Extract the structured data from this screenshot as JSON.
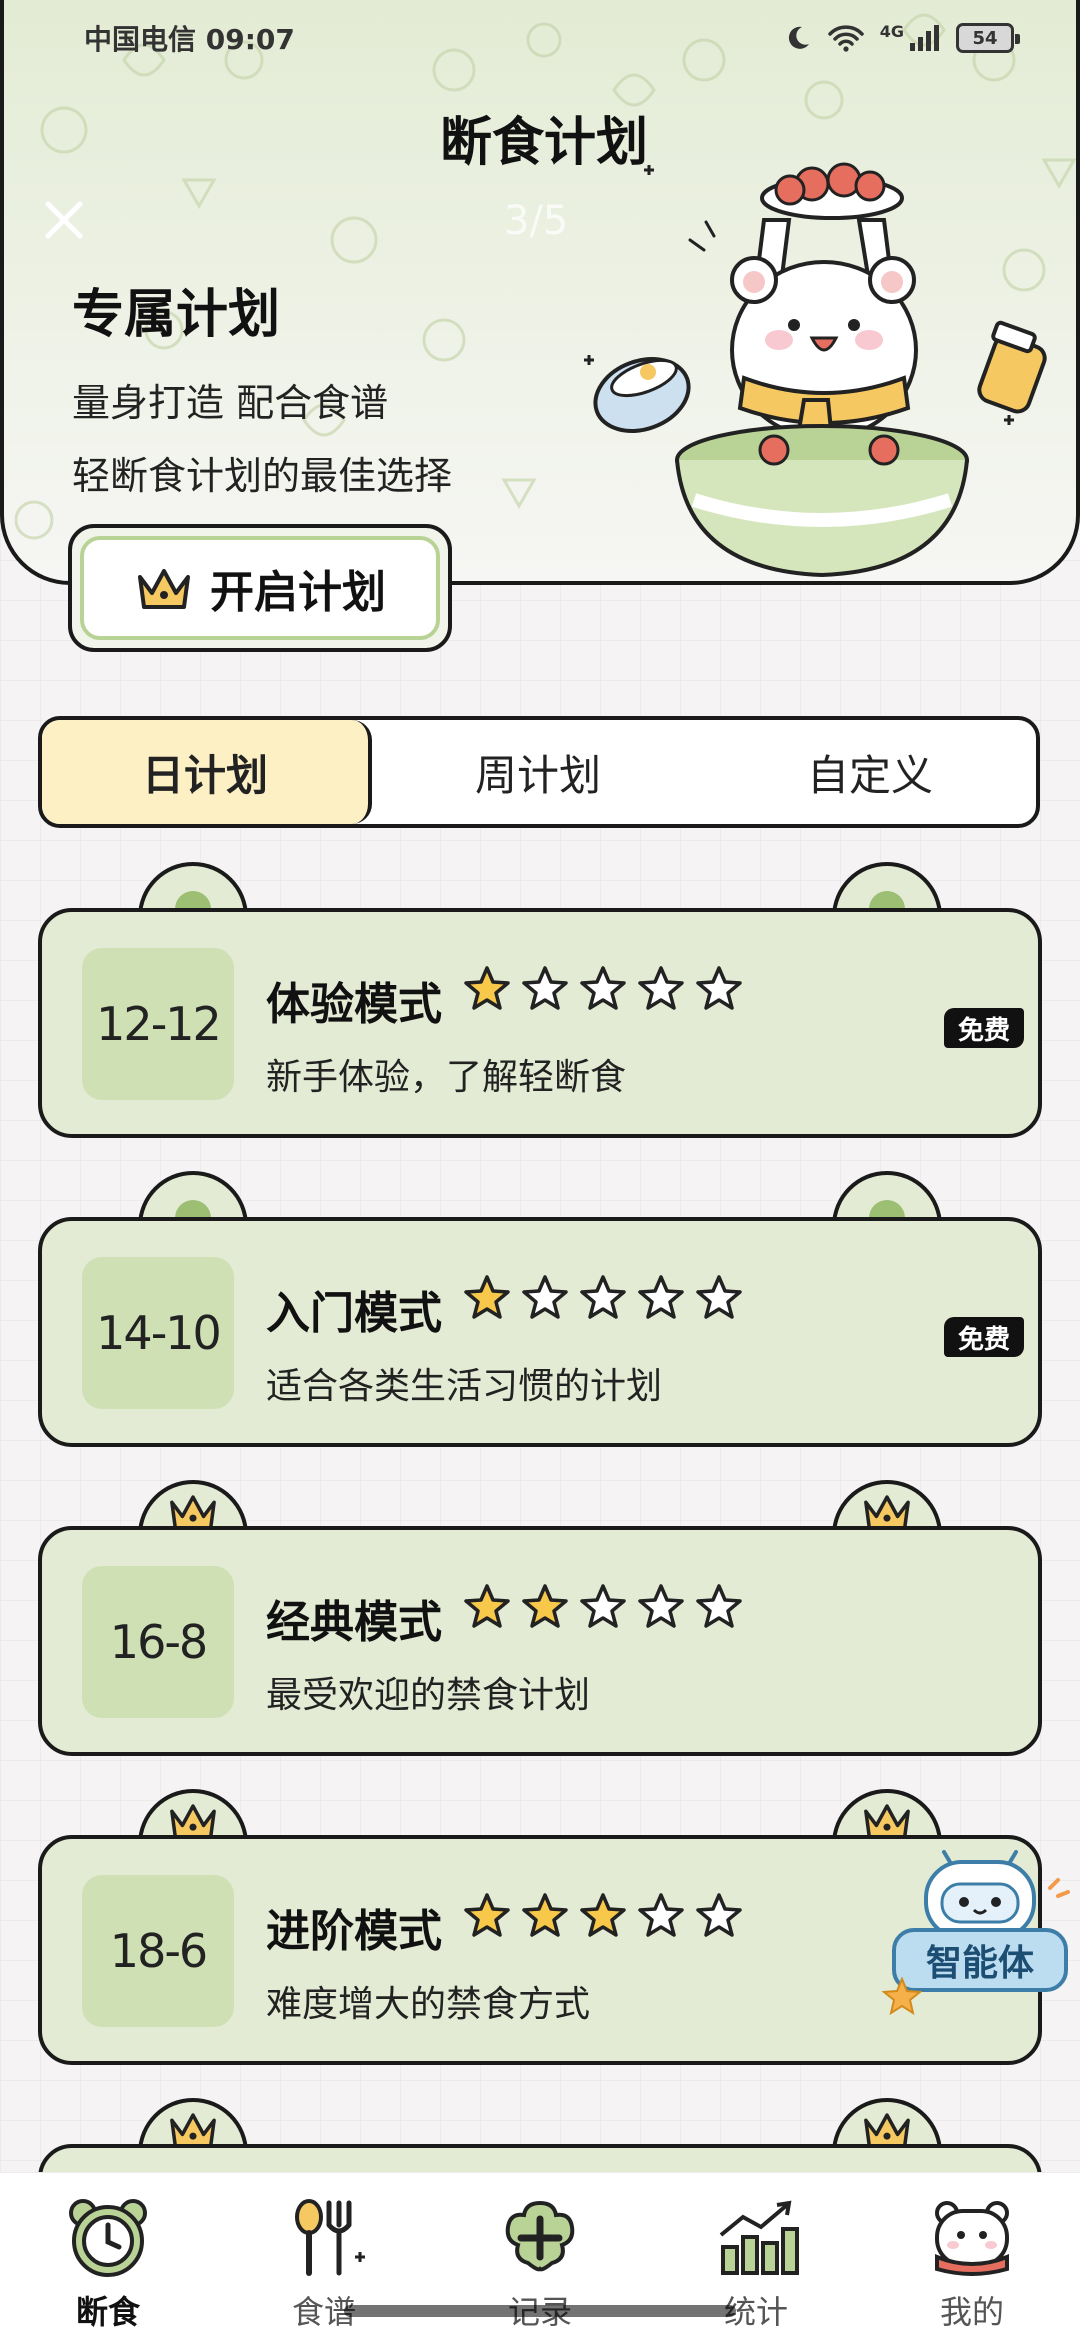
{
  "status_bar": {
    "carrier_time": "中国电信 09:07",
    "network": "4G",
    "battery": "54"
  },
  "header": {
    "title": "断食计划",
    "pager": "3/5",
    "promo_title": "专属计划",
    "promo_line1": "量身打造 配合食谱",
    "promo_line2": "轻断食计划的最佳选择",
    "start_button": "开启计划"
  },
  "tabs": [
    {
      "label": "日计划",
      "active": true
    },
    {
      "label": "周计划",
      "active": false
    },
    {
      "label": "自定义",
      "active": false
    }
  ],
  "plans": [
    {
      "ratio": "12-12",
      "name": "体验模式",
      "stars": 1,
      "desc": "新手体验，了解轻断食",
      "tag": "免费",
      "premium": false
    },
    {
      "ratio": "14-10",
      "name": "入门模式",
      "stars": 1,
      "desc": "适合各类生活习惯的计划",
      "tag": "免费",
      "premium": false
    },
    {
      "ratio": "16-8",
      "name": "经典模式",
      "stars": 2,
      "desc": "最受欢迎的禁食计划",
      "tag": "",
      "premium": true
    },
    {
      "ratio": "18-6",
      "name": "进阶模式",
      "stars": 3,
      "desc": "难度增大的禁食方式",
      "tag": "",
      "premium": true
    }
  ],
  "agent": {
    "label": "智能体"
  },
  "bottom_nav": [
    {
      "label": "断食",
      "icon": "clock-icon",
      "active": true
    },
    {
      "label": "食谱",
      "icon": "utensils-icon",
      "active": false
    },
    {
      "label": "记录",
      "icon": "add-record-icon",
      "active": false
    },
    {
      "label": "统计",
      "icon": "stats-icon",
      "active": false
    },
    {
      "label": "我的",
      "icon": "profile-icon",
      "active": false
    }
  ],
  "colors": {
    "card_bg": "#e3ebd4",
    "badge_bg": "#cfe0b4",
    "tab_active": "#fdf0c5",
    "star_fill": "#f7c84a",
    "accent_green": "#9cbf74"
  }
}
